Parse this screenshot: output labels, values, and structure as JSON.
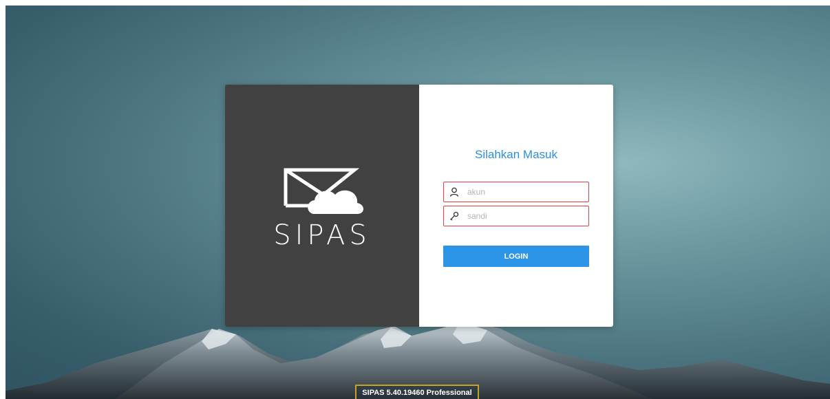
{
  "login": {
    "title": "Silahkan Masuk",
    "username_placeholder": "akun",
    "password_placeholder": "sandi",
    "button_label": "LOGIN"
  },
  "brand": {
    "name": "SIPAS"
  },
  "footer": {
    "version": "SIPAS 5.40.19460 Professional"
  },
  "colors": {
    "accent": "#2c95e8",
    "error_border": "#e2413f",
    "brand_panel": "#414141",
    "version_border": "#c8a221"
  }
}
